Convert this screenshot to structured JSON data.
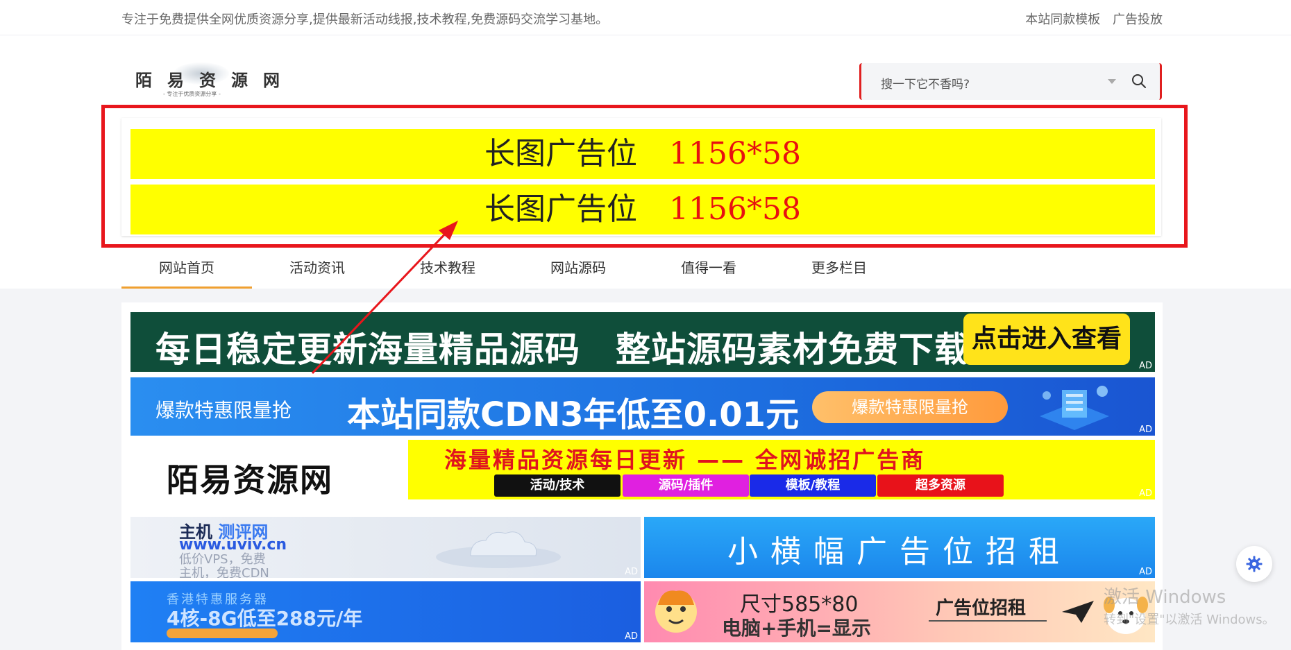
{
  "topbar": {
    "tagline": "专注于免费提供全网优质资源分享,提供最新活动线报,技术教程,免费源码交流学习基地。",
    "links": [
      "本站同款模板",
      "广告投放"
    ]
  },
  "logo": {
    "text": "陌易资源网",
    "slogan": "- 专注于优质资源分享 -"
  },
  "search": {
    "placeholder": "搜一下它不香吗?",
    "icon": "search-icon"
  },
  "top_ads": [
    {
      "label": "长图广告位",
      "size": "1156*58"
    },
    {
      "label": "长图广告位",
      "size": "1156*58"
    }
  ],
  "nav": {
    "items": [
      "网站首页",
      "活动资讯",
      "技术教程",
      "网站源码",
      "值得一看",
      "更多栏目"
    ],
    "active": 0
  },
  "banners": {
    "ad_label": "AD",
    "b1": {
      "text": "每日稳定更新海量精品源码　整站源码素材免费下载",
      "button": "点击进入查看"
    },
    "b2": {
      "small": "爆款特惠限量抢",
      "big": "本站同款CDN3年低至0.01元",
      "pill": "爆款特惠限量抢"
    },
    "b3": {
      "logo": "陌易资源网",
      "headline": "海量精品资源每日更新 —— 全网诚招广告商",
      "tags": [
        "活动/技术",
        "源码/插件",
        "模板/教程",
        "超多资源"
      ],
      "tag_colors": [
        "#111111",
        "#e020e0",
        "#1a2ae8",
        "#e8121a"
      ]
    },
    "b4": {
      "line1_a": "主机",
      "line1_b": "测评网",
      "line2": "www.uviv.cn",
      "line3": "低价VPS，免费",
      "line4": "主机，免费CDN"
    },
    "b5": {
      "text": "小横幅广告位招租"
    },
    "b6": {
      "line1": "香港特惠服务器",
      "line2": "4核-8G低至288元/年"
    },
    "b7": {
      "line1": "尺寸585*80",
      "line2": "电脑+手机=显示",
      "right": "广告位招租"
    }
  },
  "watermark": {
    "line1": "激活 Windows",
    "line2": "转到\"设置\"以激活 Windows。"
  },
  "colors": {
    "accent": "#f0a030",
    "annotation_red": "#e8161c",
    "ad_yellow": "#ffff00",
    "gear_blue": "#3a66e0"
  }
}
